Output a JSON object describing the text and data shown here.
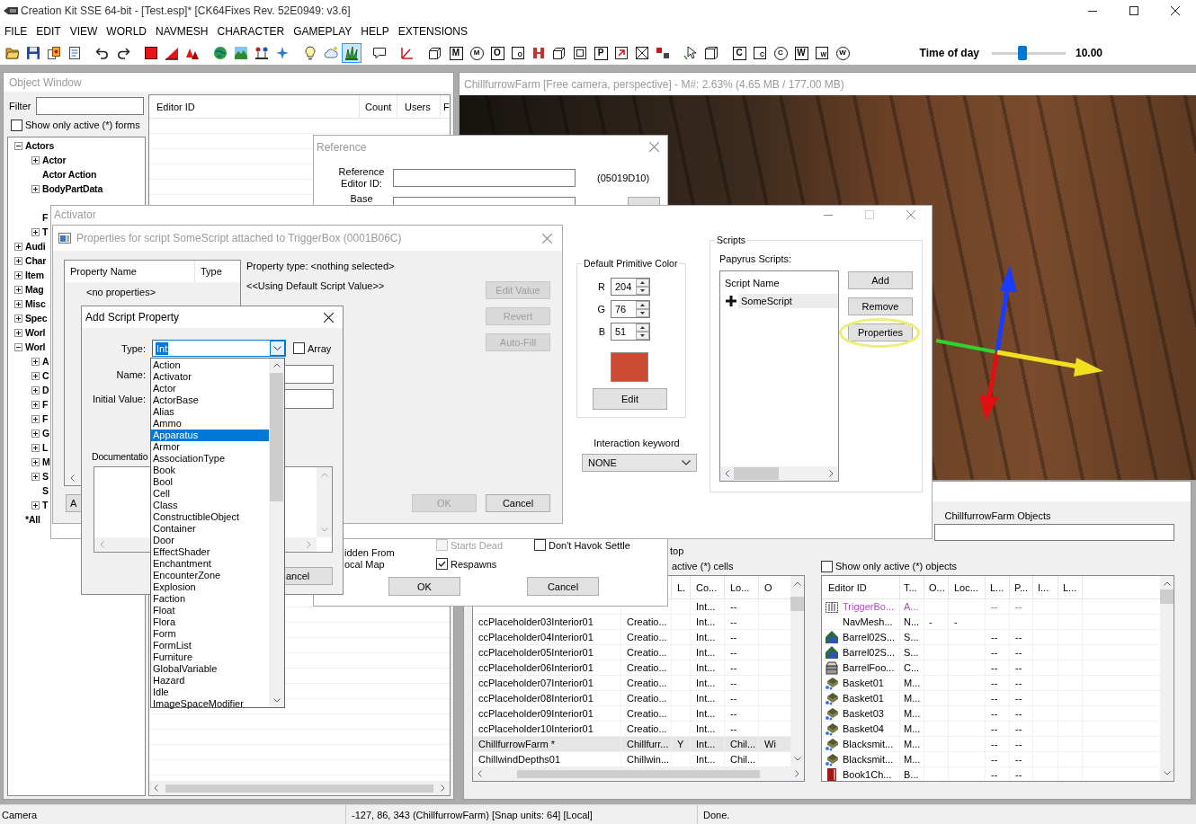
{
  "window": {
    "title": "Creation Kit SSE 64-bit - [Test.esp]* [CK64Fixes Rev. 52E0949: v3.6]"
  },
  "menu": [
    "FILE",
    "EDIT",
    "VIEW",
    "WORLD",
    "NAVMESH",
    "CHARACTER",
    "GAMEPLAY",
    "HELP",
    "EXTENSIONS"
  ],
  "toolbar": {
    "buttons": [
      {
        "kind": "icon",
        "on": false
      },
      {
        "kind": "icon",
        "on": false
      },
      {
        "kind": "icon",
        "on": false
      },
      {
        "kind": "icon",
        "on": false
      },
      {
        "kind": "icon",
        "on": false
      },
      {
        "kind": "icon",
        "on": false
      },
      {
        "kind": "icon",
        "on": false
      },
      {
        "kind": "icon",
        "on": false
      },
      {
        "kind": "icon",
        "on": false
      },
      {
        "kind": "icon",
        "on": false
      },
      {
        "kind": "icon",
        "on": false
      },
      {
        "kind": "icon",
        "on": false
      },
      {
        "kind": "icon",
        "on": false
      },
      {
        "kind": "icon",
        "on": false
      },
      {
        "kind": "icon",
        "on": false
      },
      {
        "kind": "icon",
        "on": true
      },
      {
        "kind": "icon",
        "on": false
      },
      {
        "kind": "icon",
        "on": false
      },
      {
        "kind": "icon",
        "on": false
      },
      {
        "kind": "box",
        "glyph": "M",
        "on": false
      },
      {
        "kind": "circle",
        "glyph": "M",
        "on": false
      },
      {
        "kind": "box",
        "glyph": "O",
        "on": false
      },
      {
        "kind": "small",
        "glyph": "O",
        "on": false
      },
      {
        "kind": "icon",
        "on": false
      },
      {
        "kind": "icon",
        "on": false
      },
      {
        "kind": "icon",
        "on": false
      },
      {
        "kind": "box",
        "glyph": "P",
        "on": false
      },
      {
        "kind": "icon",
        "on": false
      },
      {
        "kind": "icon",
        "on": false
      },
      {
        "kind": "icon",
        "on": false
      },
      {
        "kind": "icon",
        "on": false
      },
      {
        "kind": "icon",
        "on": false
      },
      {
        "kind": "box",
        "glyph": "C",
        "on": false
      },
      {
        "kind": "small",
        "glyph": "C",
        "on": false
      },
      {
        "kind": "circle",
        "glyph": "C",
        "on": false
      },
      {
        "kind": "box",
        "glyph": "W",
        "on": false
      },
      {
        "kind": "small",
        "glyph": "W",
        "on": false
      },
      {
        "kind": "circle",
        "glyph": "W",
        "on": false
      }
    ],
    "time_of_day": {
      "label": "Time of day",
      "level": 0.42,
      "value": "10.00"
    }
  },
  "object_window": {
    "title": "Object Window",
    "filter": {
      "label": "Filter"
    },
    "active_only": {
      "label": "Show only active (*) forms",
      "checked": false
    },
    "tree": [
      {
        "label": "Actors",
        "kind": "folder",
        "expanded": true,
        "children": [
          {
            "label": "Actor",
            "kind": "folder",
            "expanded": false
          },
          {
            "label": "Actor Action",
            "kind": "leaf"
          },
          {
            "label": "BodyPartData",
            "kind": "folder",
            "expanded": false
          },
          {
            "label": "F",
            "kind": "leaf"
          },
          {
            "label": "T",
            "kind": "folder",
            "expanded": false
          }
        ]
      },
      {
        "label": "Audi",
        "kind": "folder",
        "expanded": false
      },
      {
        "label": "Char",
        "kind": "folder",
        "expanded": false
      },
      {
        "label": "Item",
        "kind": "folder",
        "expanded": false
      },
      {
        "label": "Mag",
        "kind": "folder",
        "expanded": false
      },
      {
        "label": "Misc",
        "kind": "folder",
        "expanded": false
      },
      {
        "label": "Spec",
        "kind": "folder",
        "expanded": false
      },
      {
        "label": "Worl",
        "kind": "folder",
        "expanded": false
      },
      {
        "label": "Worl",
        "kind": "folder",
        "expanded": true,
        "children": [
          {
            "label": "A",
            "kind": "folder",
            "expanded": false
          },
          {
            "label": "C",
            "kind": "folder",
            "expanded": false
          },
          {
            "label": "D",
            "kind": "folder",
            "expanded": false
          },
          {
            "label": "F",
            "kind": "folder",
            "expanded": false
          },
          {
            "label": "F",
            "kind": "folder",
            "expanded": false
          },
          {
            "label": "G",
            "kind": "folder",
            "expanded": false
          },
          {
            "label": "L",
            "kind": "folder",
            "expanded": false
          },
          {
            "label": "M",
            "kind": "folder",
            "expanded": false
          },
          {
            "label": "S",
            "kind": "folder",
            "expanded": false
          },
          {
            "label": "S",
            "kind": "leaf"
          },
          {
            "label": "T",
            "kind": "folder",
            "expanded": false
          }
        ]
      },
      {
        "label": "*All",
        "kind": "leaf"
      }
    ],
    "table": {
      "columns": [
        "Editor ID",
        "Count",
        "Users",
        "F"
      ]
    }
  },
  "render_window": {
    "title": "ChillfurrowFarm [Free camera, perspective] - M#: 2.63% (4.65 MB / 177.00 MB)"
  },
  "cell_view": {
    "notes": [
      "top",
      "active (*) cells"
    ],
    "cells_table": {
      "columns": [
        null,
        null,
        "L.",
        "Co...",
        "Lo...",
        "O"
      ],
      "rows": [
        {
          "cells": [
            null,
            null,
            null,
            "Int...",
            "--",
            null
          ],
          "selected": false
        },
        {
          "cells": [
            "ccPlaceholder03Interior01",
            "Creatio...",
            null,
            "Int...",
            "--",
            null
          ],
          "selected": false
        },
        {
          "cells": [
            "ccPlaceholder04Interior01",
            "Creatio...",
            null,
            "Int...",
            "--",
            null
          ],
          "selected": false
        },
        {
          "cells": [
            "ccPlaceholder05Interior01",
            "Creatio...",
            null,
            "Int...",
            "--",
            null
          ],
          "selected": false
        },
        {
          "cells": [
            "ccPlaceholder06Interior01",
            "Creatio...",
            null,
            "Int...",
            "--",
            null
          ],
          "selected": false
        },
        {
          "cells": [
            "ccPlaceholder07Interior01",
            "Creatio...",
            null,
            "Int...",
            "--",
            null
          ],
          "selected": false
        },
        {
          "cells": [
            "ccPlaceholder08Interior01",
            "Creatio...",
            null,
            "Int...",
            "--",
            null
          ],
          "selected": false
        },
        {
          "cells": [
            "ccPlaceholder09Interior01",
            "Creatio...",
            null,
            "Int...",
            "--",
            null
          ],
          "selected": false
        },
        {
          "cells": [
            "ccPlaceholder10Interior01",
            "Creatio...",
            null,
            "Int...",
            "--",
            null
          ],
          "selected": false
        },
        {
          "cells": [
            "ChillfurrowFarm *",
            "Chillfurr...",
            "Y",
            "Int...",
            "Chil...",
            "Wi"
          ],
          "selected": true
        },
        {
          "cells": [
            "ChillwindDepths01",
            "Chillwin...",
            null,
            "Int...",
            "Chil...",
            null
          ],
          "selected": false
        }
      ]
    },
    "objects_title": "ChillfurrowFarm Objects",
    "objects_active_only": {
      "label": "Show only active (*) objects",
      "checked": false
    },
    "objects_table": {
      "columns": [
        "Editor ID",
        "T...",
        "O...",
        "Loc...",
        "L...",
        "P...",
        "I...",
        "L..."
      ],
      "rows": [
        {
          "kind": "trigger",
          "color": "#b44cc4",
          "cells": [
            "TriggerBo...",
            "A...",
            null,
            null,
            "--",
            "--",
            null,
            null
          ]
        },
        {
          "kind": "navmesh",
          "color": "#000000",
          "cells": [
            "NavMesh...",
            "N...",
            "-",
            "-",
            null,
            null,
            null,
            null
          ]
        },
        {
          "kind": "activator",
          "color": "#000000",
          "cells": [
            "Barrel02S...",
            "S...",
            null,
            null,
            "--",
            "--",
            null,
            null
          ]
        },
        {
          "kind": "activator",
          "color": "#000000",
          "cells": [
            "Barrel02S...",
            "S...",
            null,
            null,
            "--",
            "--",
            null,
            null
          ]
        },
        {
          "kind": "container",
          "color": "#000000",
          "cells": [
            "BarrelFoo...",
            "C...",
            null,
            null,
            "--",
            "--",
            null,
            null
          ]
        },
        {
          "kind": "static",
          "color": "#000000",
          "cells": [
            "Basket01",
            "M...",
            null,
            null,
            "--",
            "--",
            null,
            null
          ]
        },
        {
          "kind": "static",
          "color": "#000000",
          "cells": [
            "Basket01",
            "M...",
            null,
            null,
            "--",
            "--",
            null,
            null
          ]
        },
        {
          "kind": "static",
          "color": "#000000",
          "cells": [
            "Basket03",
            "M...",
            null,
            null,
            "--",
            "--",
            null,
            null
          ]
        },
        {
          "kind": "static",
          "color": "#000000",
          "cells": [
            "Basket04",
            "M...",
            null,
            null,
            "--",
            "--",
            null,
            null
          ]
        },
        {
          "kind": "static",
          "color": "#000000",
          "cells": [
            "Blacksmit...",
            "M...",
            null,
            null,
            "--",
            "--",
            null,
            null
          ]
        },
        {
          "kind": "static",
          "color": "#000000",
          "cells": [
            "Blacksmit...",
            "M...",
            null,
            null,
            "--",
            "--",
            null,
            null
          ]
        },
        {
          "kind": "book",
          "color": "#000000",
          "cells": [
            "Book1Ch...",
            "B...",
            null,
            null,
            "--",
            "--",
            null,
            null
          ]
        }
      ]
    }
  },
  "reference_dialog": {
    "title": "Reference",
    "editor_id_label": "Reference Editor ID:",
    "form_id": "(05019D10)",
    "base_label": "Base",
    "side_label": "idden From ocal Map",
    "checkboxes": [
      {
        "label": "Starts Dead",
        "checked": false,
        "disabled": true
      },
      {
        "label": "Don't Havok Settle",
        "checked": false,
        "disabled": false
      },
      {
        "label": "Respawns",
        "checked": true,
        "disabled": false
      }
    ],
    "buttons": [
      "OK",
      "Cancel"
    ]
  },
  "activator_window": {
    "title": "Activator",
    "color_group": {
      "title": "Default Primitive Color",
      "channels": [
        {
          "label": "R",
          "value": "204"
        },
        {
          "label": "G",
          "value": "76"
        },
        {
          "label": "B",
          "value": "51"
        }
      ],
      "swatch": {
        "color": "#cc4c33"
      },
      "button": "Edit"
    },
    "keyword": {
      "label": "Interaction keyword",
      "value": "NONE"
    },
    "scripts": {
      "title": "Scripts",
      "list_label": "Papyrus Scripts:",
      "column": "Script Name",
      "items": [
        {
          "name": "SomeScript",
          "selected": true
        }
      ],
      "buttons": [
        {
          "label": "Add",
          "highlighted": false
        },
        {
          "label": "Remove",
          "highlighted": false
        },
        {
          "label": "Properties",
          "highlighted": true
        }
      ]
    }
  },
  "properties_dialog": {
    "title": "Properties for script SomeScript attached to TriggerBox (0001B06C)",
    "columns": [
      "Property Name",
      "Type"
    ],
    "empty_row": "<no properties>",
    "property_type": "Property type: <nothing selected>",
    "value_note": "<<Using Default Script Value>>",
    "side_buttons": [
      {
        "label": "Edit Value",
        "disabled": true
      },
      {
        "label": "Revert",
        "disabled": true
      },
      {
        "label": "Auto-Fill",
        "disabled": true
      }
    ],
    "footer_buttons": [
      {
        "label": "A",
        "disabled": false
      },
      {
        "label": "OK",
        "disabled": true
      },
      {
        "label": "Cancel",
        "disabled": false
      }
    ]
  },
  "add_property_dialog": {
    "title": "Add Script Property",
    "type": {
      "label": "Type:",
      "value": "Int",
      "highlighted": true
    },
    "array": {
      "label": "Array",
      "checked": false
    },
    "name_label": "Name:",
    "initial_value_label": "Initial Value:",
    "documentation_label": "Documentatio",
    "cancel_button": "ancel",
    "type_options": [
      {
        "label": "Action",
        "selected": false
      },
      {
        "label": "Activator",
        "selected": false
      },
      {
        "label": "Actor",
        "selected": false
      },
      {
        "label": "ActorBase",
        "selected": false
      },
      {
        "label": "Alias",
        "selected": false
      },
      {
        "label": "Ammo",
        "selected": false
      },
      {
        "label": "Apparatus",
        "selected": true
      },
      {
        "label": "Armor",
        "selected": false
      },
      {
        "label": "AssociationType",
        "selected": false
      },
      {
        "label": "Book",
        "selected": false
      },
      {
        "label": "Bool",
        "selected": false
      },
      {
        "label": "Cell",
        "selected": false
      },
      {
        "label": "Class",
        "selected": false
      },
      {
        "label": "ConstructibleObject",
        "selected": false
      },
      {
        "label": "Container",
        "selected": false
      },
      {
        "label": "Door",
        "selected": false
      },
      {
        "label": "EffectShader",
        "selected": false
      },
      {
        "label": "Enchantment",
        "selected": false
      },
      {
        "label": "EncounterZone",
        "selected": false
      },
      {
        "label": "Explosion",
        "selected": false
      },
      {
        "label": "Faction",
        "selected": false
      },
      {
        "label": "Float",
        "selected": false
      },
      {
        "label": "Flora",
        "selected": false
      },
      {
        "label": "Form",
        "selected": false
      },
      {
        "label": "FormList",
        "selected": false
      },
      {
        "label": "Furniture",
        "selected": false
      },
      {
        "label": "GlobalVariable",
        "selected": false
      },
      {
        "label": "Hazard",
        "selected": false
      },
      {
        "label": "Idle",
        "selected": false
      },
      {
        "label": "ImageSpaceModifier",
        "selected": false
      }
    ]
  },
  "status_bar": [
    "Camera",
    "-127, 86, 343 (ChillfurrowFarm) [Snap units: 64] [Local]",
    "Done."
  ]
}
